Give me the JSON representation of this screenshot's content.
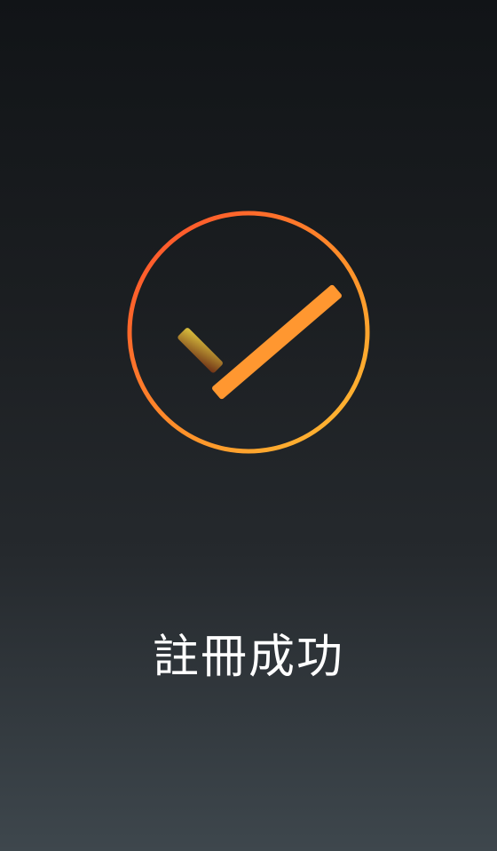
{
  "status": {
    "message": "註冊成功",
    "icon": "check-circle-icon"
  },
  "colors": {
    "ring_start": "#ff4a2c",
    "ring_mid": "#ff8f2a",
    "ring_end": "#ffbf33",
    "check_long": "#ff9730",
    "check_short_top": "#dcc33e",
    "check_short_bottom": "#6d2f16",
    "background_top": "#111417",
    "background_bottom": "#3e474d"
  }
}
